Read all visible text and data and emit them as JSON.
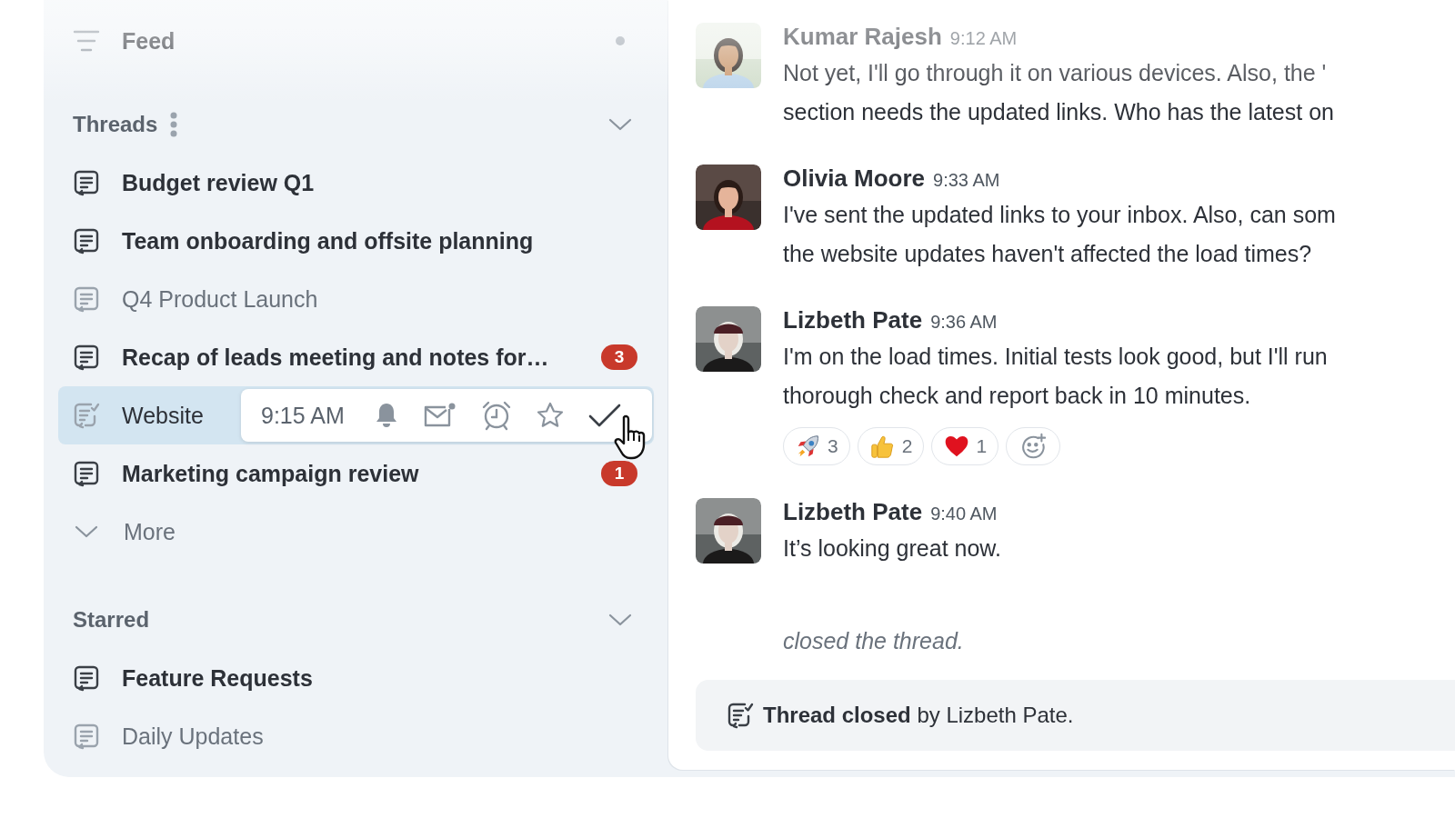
{
  "sidebar": {
    "feed": {
      "label": "Feed",
      "unread": true
    },
    "sections": [
      {
        "title": "Threads",
        "menu": true,
        "expanded": true,
        "items": [
          {
            "label": "Budget review Q1",
            "unread": true,
            "selected": false,
            "closed": false
          },
          {
            "label": "Team onboarding and offsite planning",
            "unread": true,
            "selected": false,
            "closed": false
          },
          {
            "label": "Q4 Product Launch",
            "unread": false,
            "selected": false,
            "closed": false
          },
          {
            "label": "Recap of leads meeting and notes for…",
            "unread": true,
            "selected": false,
            "closed": false,
            "badge": "3"
          },
          {
            "label": "Website",
            "unread": false,
            "selected": true,
            "closed": true,
            "hover_actions": {
              "time": "9:15 AM"
            }
          },
          {
            "label": "Marketing campaign review",
            "unread": true,
            "selected": false,
            "closed": false,
            "badge": "1"
          }
        ],
        "more": {
          "label": "More"
        }
      },
      {
        "title": "Starred",
        "menu": false,
        "expanded": true,
        "items": [
          {
            "label": "Feature Requests",
            "unread": true,
            "selected": false,
            "closed": false
          },
          {
            "label": "Daily Updates",
            "unread": false,
            "selected": false,
            "closed": false
          }
        ]
      }
    ]
  },
  "chat": {
    "messages": [
      {
        "author": "Kumar Rajesh",
        "time": "9:12 AM",
        "lines": [
          "Not yet, I'll go through it on various devices. Also, the '",
          "section needs the updated links. Who has the latest on"
        ]
      },
      {
        "author": "Olivia Moore",
        "time": "9:33 AM",
        "lines": [
          "I've sent the updated links to your inbox. Also, can som",
          "the website updates haven't affected the load times?"
        ]
      },
      {
        "author": "Lizbeth Pate",
        "time": "9:36 AM",
        "lines": [
          "I'm on the load times. Initial tests look good, but I'll run",
          "thorough check and report back in 10 minutes."
        ],
        "reactions": [
          {
            "kind": "rocket",
            "count": "3"
          },
          {
            "kind": "thumbs_up",
            "count": "2"
          },
          {
            "kind": "heart",
            "count": "1"
          }
        ],
        "add_reaction": true
      },
      {
        "author": "Lizbeth Pate",
        "time": "9:40 AM",
        "lines": [
          "It’s looking great now."
        ]
      }
    ],
    "system_note": "closed the thread.",
    "banner": "**Thread closed** by Lizbeth Pate."
  }
}
